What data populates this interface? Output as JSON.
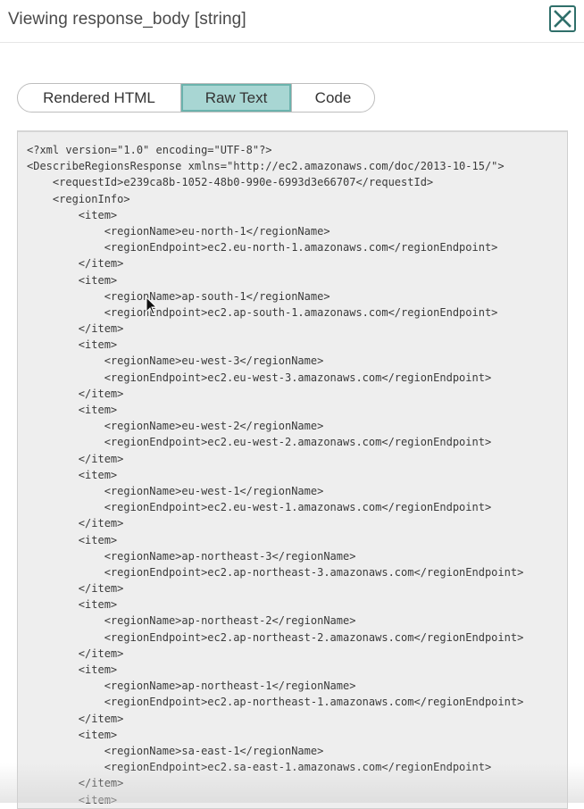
{
  "header": {
    "title": "Viewing response_body [string]",
    "close_icon": "close-x-icon"
  },
  "tabs": [
    {
      "label": "Rendered HTML",
      "active": false
    },
    {
      "label": "Raw Text",
      "active": true
    },
    {
      "label": "Code",
      "active": false
    }
  ],
  "colors": {
    "active_tab_bg": "#a8d6d3",
    "active_tab_border": "#6bb3ad",
    "close_border": "#2f6f6a",
    "code_bg": "#eeeeee"
  },
  "code": {
    "lines": [
      "<?xml version=\"1.0\" encoding=\"UTF-8\"?>",
      "<DescribeRegionsResponse xmlns=\"http://ec2.amazonaws.com/doc/2013-10-15/\">",
      "    <requestId>e239ca8b-1052-48b0-990e-6993d3e66707</requestId>",
      "    <regionInfo>",
      "        <item>",
      "            <regionName>eu-north-1</regionName>",
      "            <regionEndpoint>ec2.eu-north-1.amazonaws.com</regionEndpoint>",
      "        </item>",
      "        <item>",
      "            <regionName>ap-south-1</regionName>",
      "            <regionEndpoint>ec2.ap-south-1.amazonaws.com</regionEndpoint>",
      "        </item>",
      "        <item>",
      "            <regionName>eu-west-3</regionName>",
      "            <regionEndpoint>ec2.eu-west-3.amazonaws.com</regionEndpoint>",
      "        </item>",
      "        <item>",
      "            <regionName>eu-west-2</regionName>",
      "            <regionEndpoint>ec2.eu-west-2.amazonaws.com</regionEndpoint>",
      "        </item>",
      "        <item>",
      "            <regionName>eu-west-1</regionName>",
      "            <regionEndpoint>ec2.eu-west-1.amazonaws.com</regionEndpoint>",
      "        </item>",
      "        <item>",
      "            <regionName>ap-northeast-3</regionName>",
      "            <regionEndpoint>ec2.ap-northeast-3.amazonaws.com</regionEndpoint>",
      "        </item>",
      "        <item>",
      "            <regionName>ap-northeast-2</regionName>",
      "            <regionEndpoint>ec2.ap-northeast-2.amazonaws.com</regionEndpoint>",
      "        </item>",
      "        <item>",
      "            <regionName>ap-northeast-1</regionName>",
      "            <regionEndpoint>ec2.ap-northeast-1.amazonaws.com</regionEndpoint>",
      "        </item>",
      "        <item>",
      "            <regionName>sa-east-1</regionName>",
      "            <regionEndpoint>ec2.sa-east-1.amazonaws.com</regionEndpoint>",
      "        </item>",
      "        <item>"
    ]
  }
}
